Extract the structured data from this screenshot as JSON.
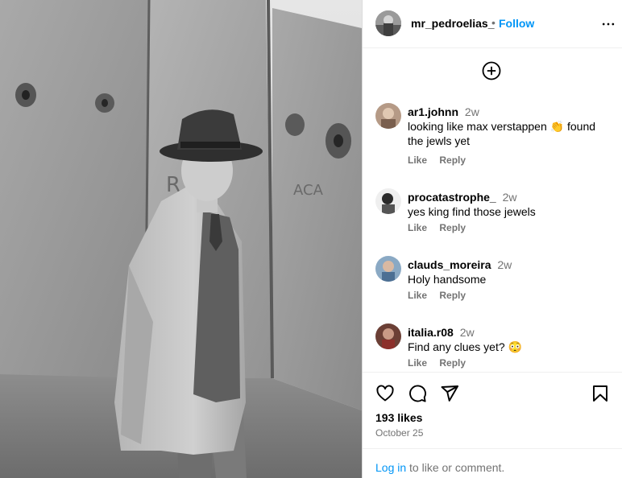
{
  "post": {
    "author": "mr_pedroelias_",
    "separator": "•",
    "follow_label": "Follow",
    "likes": "193 likes",
    "date": "October 25"
  },
  "comments": [
    {
      "username": "ar1.johnn",
      "time": "2w",
      "text_pre": "looking like max verstappen ",
      "emoji": "👏",
      "text_post": " found the jewls yet",
      "like_label": "Like",
      "reply_label": "Reply"
    },
    {
      "username": "procatastrophe_",
      "time": "2w",
      "text": "yes king find those jewels",
      "like_label": "Like",
      "reply_label": "Reply"
    },
    {
      "username": "clauds_moreira",
      "time": "2w",
      "text": "Holy handsome",
      "like_label": "Like",
      "reply_label": "Reply"
    },
    {
      "username": "italia.r08",
      "time": "2w",
      "text_pre": "Find any clues yet? ",
      "emoji": "😳",
      "like_label": "Like",
      "reply_label": "Reply"
    }
  ],
  "footer": {
    "login_link": "Log in",
    "login_suffix": " to like or comment."
  },
  "icons": {
    "more": "more-options-icon",
    "add": "add-comment-icon",
    "like": "heart-icon",
    "comment": "comment-icon",
    "share": "share-icon",
    "save": "bookmark-icon"
  },
  "colors": {
    "link": "#0095f6",
    "muted": "#737373",
    "border": "#dbdbdb"
  }
}
